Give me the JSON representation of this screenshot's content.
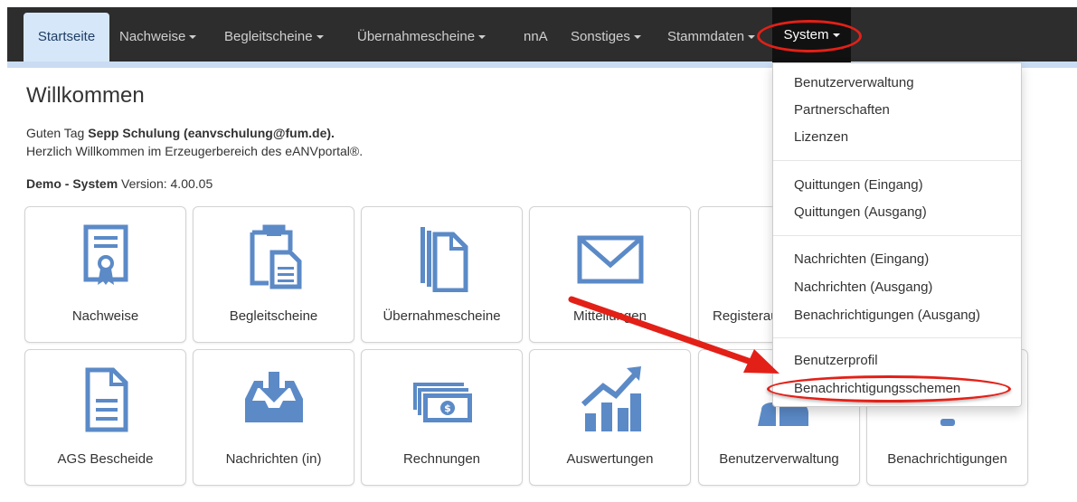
{
  "nav": {
    "items": [
      {
        "label": "Startseite",
        "caret": false
      },
      {
        "label": "Nachweise",
        "caret": true
      },
      {
        "label": "Begleitscheine",
        "caret": true
      },
      {
        "label": "Übernahmescheine",
        "caret": true
      },
      {
        "label": "nnA",
        "caret": false
      },
      {
        "label": "Sonstiges",
        "caret": true
      },
      {
        "label": "Stammdaten",
        "caret": true
      },
      {
        "label": "System",
        "caret": true
      }
    ]
  },
  "welcome": {
    "title": "Willkommen",
    "greeting_prefix": "Guten Tag ",
    "user": "Sepp Schulung (eanvschulung@fum.de).",
    "line2": "Herzlich Willkommen im Erzeugerbereich des eANVportal®.",
    "system_label": "Demo - System",
    "version_label": " Version: 4.00.05"
  },
  "tiles": [
    {
      "label": "Nachweise",
      "icon": "certificate-icon"
    },
    {
      "label": "Begleitscheine",
      "icon": "clipboard-document-icon"
    },
    {
      "label": "Übernahmescheine",
      "icon": "stacked-documents-icon"
    },
    {
      "label": "Mitteilungen",
      "icon": "envelope-icon"
    },
    {
      "label": "Registerauszüge",
      "icon": "register-basket-icon"
    },
    {
      "label": "AGS Bescheide",
      "icon": "document-lines-icon"
    },
    {
      "label": "Nachrichten (in)",
      "icon": "inbox-download-icon"
    },
    {
      "label": "Rechnungen",
      "icon": "money-bills-icon"
    },
    {
      "label": "Auswertungen",
      "icon": "bar-chart-trend-icon"
    },
    {
      "label": "Benutzerverwaltung",
      "icon": "users-icon"
    },
    {
      "label": "Benachrichtigungen",
      "icon": "bell-icon"
    }
  ],
  "dropdown": {
    "items": [
      "Benutzerverwaltung",
      "Partnerschaften",
      "Lizenzen",
      "Quittungen (Eingang)",
      "Quittungen (Ausgang)",
      "Nachrichten (Eingang)",
      "Nachrichten (Ausgang)",
      "Benachrichtigungen (Ausgang)",
      "Benutzerprofil",
      "Benachrichtigungsschemen"
    ]
  },
  "colors": {
    "navbar": "#2d2d2d",
    "active_tab": "#d6e7f9",
    "icon_blue": "#5b8ac7",
    "highlight_red": "#e32017"
  }
}
